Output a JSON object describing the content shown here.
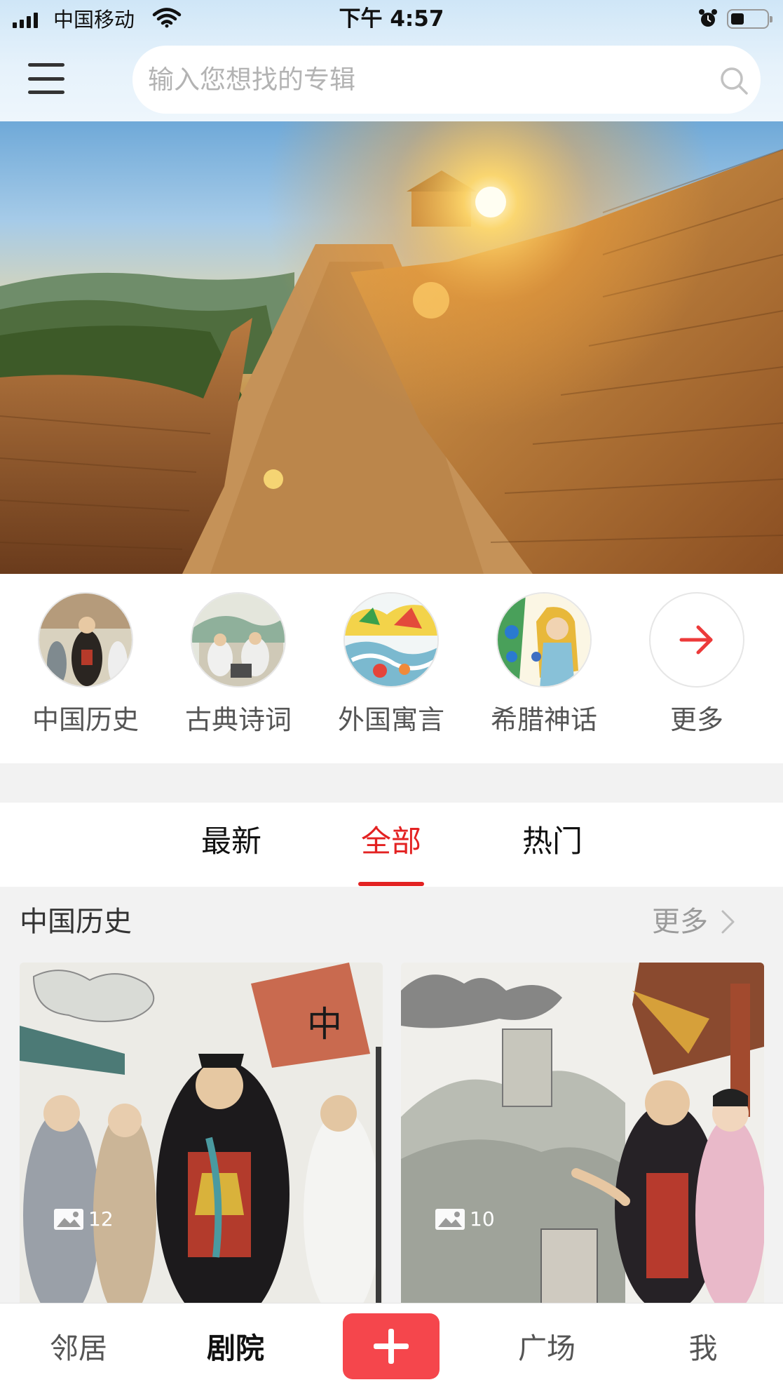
{
  "status_bar": {
    "carrier": "中国移动",
    "time": "下午 4:57"
  },
  "search": {
    "placeholder": "输入您想找的专辑"
  },
  "categories": [
    {
      "label": "中国历史"
    },
    {
      "label": "古典诗词"
    },
    {
      "label": "外国寓言"
    },
    {
      "label": "希腊神话"
    },
    {
      "label": "更多"
    }
  ],
  "tabs": [
    {
      "label": "最新"
    },
    {
      "label": "全部"
    },
    {
      "label": "热门"
    }
  ],
  "active_tab": "全部",
  "section": {
    "title": "中国历史",
    "more_label": "更多",
    "cards": [
      {
        "photo_count": "12"
      },
      {
        "photo_count": "10"
      }
    ]
  },
  "bottom_nav": {
    "items": [
      {
        "label": "邻居"
      },
      {
        "label": "剧院"
      },
      {
        "label": "广场"
      },
      {
        "label": "我"
      }
    ],
    "active": "剧院"
  },
  "colors": {
    "accent": "#e32222",
    "add_button": "#f5464c",
    "header_bg": "#dcecf9",
    "section_bg": "#f2f2f2"
  },
  "icons": [
    "menu-icon",
    "search-icon",
    "arrow-right-icon",
    "chevron-right-icon",
    "image-icon",
    "plus-icon",
    "wifi-icon",
    "alarm-icon",
    "battery-icon",
    "signal-icon"
  ]
}
